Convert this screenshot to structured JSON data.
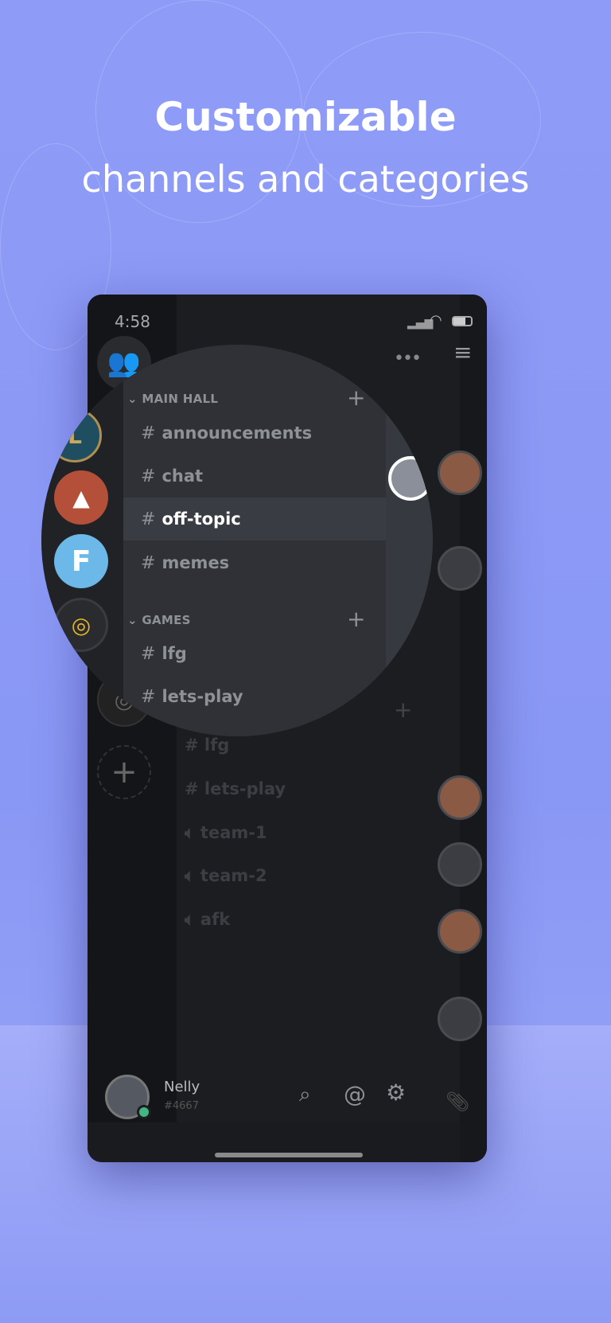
{
  "headline": {
    "line1": "Customizable",
    "line2": "channels and categories"
  },
  "status_bar": {
    "time": "4:58"
  },
  "magnified": {
    "categories": [
      {
        "name": "MAIN HALL",
        "channels": [
          {
            "name": "announcements"
          },
          {
            "name": "chat"
          },
          {
            "name": "off-topic",
            "selected": true
          },
          {
            "name": "memes"
          }
        ]
      },
      {
        "name": "GAMES",
        "channels": [
          {
            "name": "lfg"
          },
          {
            "name": "lets-play"
          }
        ]
      }
    ]
  },
  "channels_behind": [
    {
      "name": "lfg",
      "type": "text"
    },
    {
      "name": "lets-play",
      "type": "text"
    },
    {
      "name": "team-1",
      "type": "voice"
    },
    {
      "name": "team-2",
      "type": "voice"
    },
    {
      "name": "afk",
      "type": "voice"
    }
  ],
  "servers": [
    "League of Legends",
    "Apex Legends",
    "Fortnite",
    "Overwatch"
  ],
  "user": {
    "name": "Nelly",
    "tag": "#4667",
    "status": "online",
    "status_color": "#43b581"
  },
  "hash": "#",
  "colors": {
    "background": "#8f9cf7",
    "selected_channel": "#393c43"
  }
}
